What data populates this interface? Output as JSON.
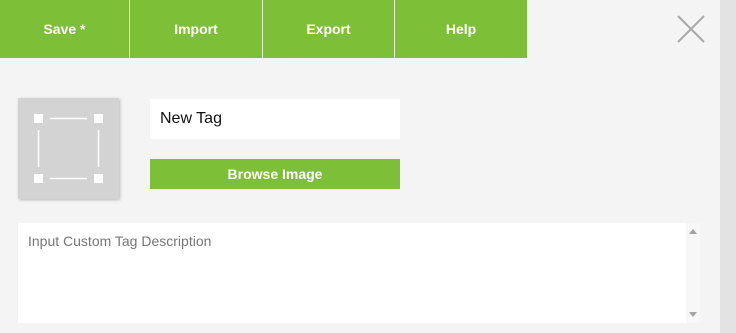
{
  "toolbar": {
    "save_label": "Save *",
    "import_label": "Import",
    "export_label": "Export",
    "help_label": "Help"
  },
  "close_icon": "close-icon",
  "image_placeholder_icon": "image-placeholder-icon",
  "tag_name": {
    "value": "New Tag"
  },
  "browse_label": "Browse Image",
  "description": {
    "placeholder": "Input Custom Tag Description",
    "value": ""
  },
  "colors": {
    "accent": "#7dbf37",
    "background": "#f4f4f4",
    "placeholder_tile": "#d3d3d3"
  }
}
